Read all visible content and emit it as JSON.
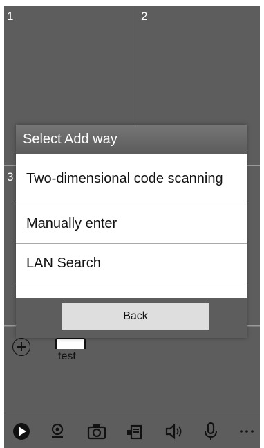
{
  "grid": {
    "cells": [
      "1",
      "2",
      "3"
    ]
  },
  "dialog": {
    "title": "Select Add way",
    "options": [
      "Two-dimensional code scanning",
      "Manually enter",
      "LAN Search"
    ],
    "back_label": "Back"
  },
  "device_strip": {
    "device_label": "test"
  },
  "toolbar": {
    "icons": [
      "play-icon",
      "camera-lens-icon",
      "snapshot-icon",
      "record-icon",
      "speaker-icon",
      "microphone-icon",
      "more-icon"
    ]
  },
  "colors": {
    "background": "#5d5d5d",
    "dialog_title": "#6a6a6a",
    "button": "#dedede"
  }
}
